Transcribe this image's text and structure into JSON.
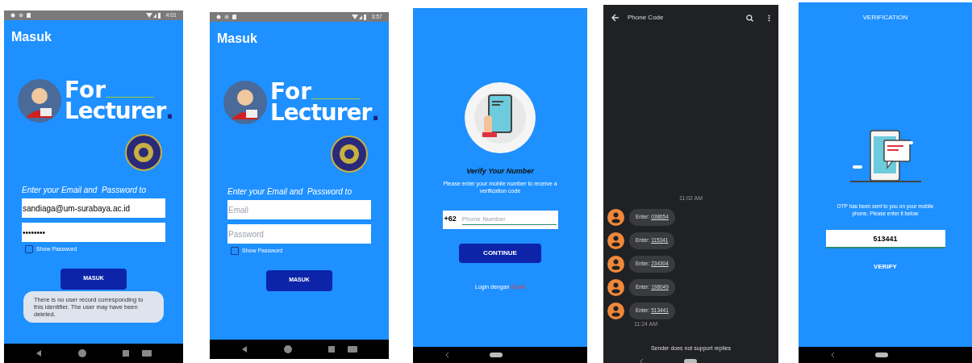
{
  "screens": [
    {
      "kind": "login",
      "status_bar": {
        "time": "4:01"
      },
      "title": "Masuk",
      "logo": {
        "line1": "For",
        "line2": "Lecturer",
        "dot": "."
      },
      "prompt": "Enter your Email and  Password to",
      "email": {
        "value": "sandiaga@um-surabaya.ac.id"
      },
      "password": {
        "value": "••••••••"
      },
      "show_password": {
        "label": "Show Password",
        "checked": false
      },
      "button": "MASUK",
      "toast": "There is no user record corresponding to this identifier. The user may have been deleted."
    },
    {
      "kind": "login",
      "status_bar": {
        "time": "3:57"
      },
      "title": "Masuk",
      "logo": {
        "line1": "For",
        "line2": "Lecturer",
        "dot": "."
      },
      "prompt": "Enter your Email and  Password to",
      "email": {
        "placeholder": "Email"
      },
      "password": {
        "placeholder": "Password"
      },
      "show_password": {
        "label": "Show Password",
        "checked": false
      },
      "button": "MASUK"
    },
    {
      "kind": "phone_verify",
      "title": "Verify Your Number",
      "subtitle": "Please enter your mobile number to receive a verification code",
      "country_code": "+62",
      "phone": {
        "placeholder": "Phone Number"
      },
      "button": "CONTINUE",
      "footer": "Login dengan",
      "link": "Email"
    },
    {
      "kind": "messages",
      "title": "Phone Code",
      "timestamp": "11:02 AM",
      "messages": [
        {
          "prefix": "Enter:",
          "code": "038654"
        },
        {
          "prefix": "Enter:",
          "code": "115341"
        },
        {
          "prefix": "Enter:",
          "code": "234304"
        },
        {
          "prefix": "Enter:",
          "code": "198049"
        },
        {
          "prefix": "Enter:",
          "code": "513441"
        }
      ],
      "last_time": "11:24 AM",
      "footer": "Sender does not support replies"
    },
    {
      "kind": "otp",
      "title": "VERIFICATION",
      "message": "OTP has been sent to you on your mobile phone. Please enter it below",
      "code": {
        "value": "513441"
      },
      "button": "VERIFY"
    }
  ]
}
